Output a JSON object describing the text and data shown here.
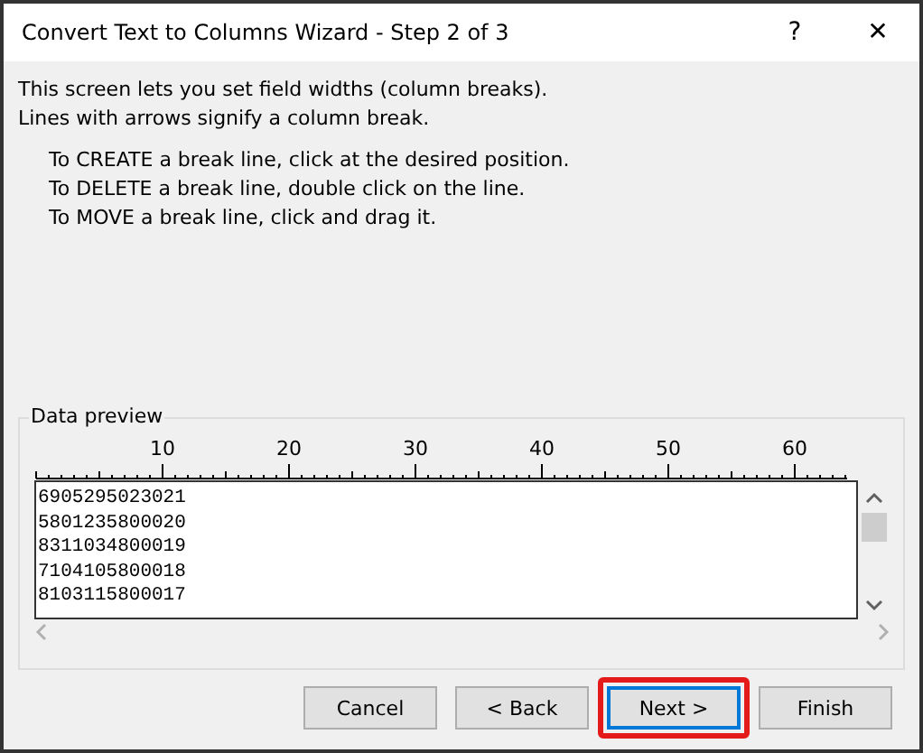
{
  "window": {
    "title": "Convert Text to Columns Wizard - Step 2 of 3",
    "help": "?",
    "close": "✕"
  },
  "intro": [
    "This screen lets you set field widths (column breaks).",
    "Lines with arrows signify a column break."
  ],
  "instructions": [
    "To CREATE a break line, click at the desired position.",
    "To DELETE a break line, double click on the line.",
    "To MOVE a break line, click and drag it."
  ],
  "preview": {
    "label": "Data preview",
    "ruler": [
      "10",
      "20",
      "30",
      "40",
      "50",
      "60"
    ],
    "rows": [
      "6905295023021",
      "5801235800020",
      "8311034800019",
      "7104105800018",
      "8103115800017"
    ]
  },
  "buttons": [
    {
      "label": "Cancel",
      "disabled": false,
      "default": false,
      "highlighted": false
    },
    {
      "label": "< Back",
      "disabled": false,
      "default": false,
      "highlighted": false
    },
    {
      "label": "Next >",
      "disabled": false,
      "default": true,
      "highlighted": true
    },
    {
      "label": "Finish",
      "disabled": false,
      "default": false,
      "highlighted": false
    }
  ]
}
